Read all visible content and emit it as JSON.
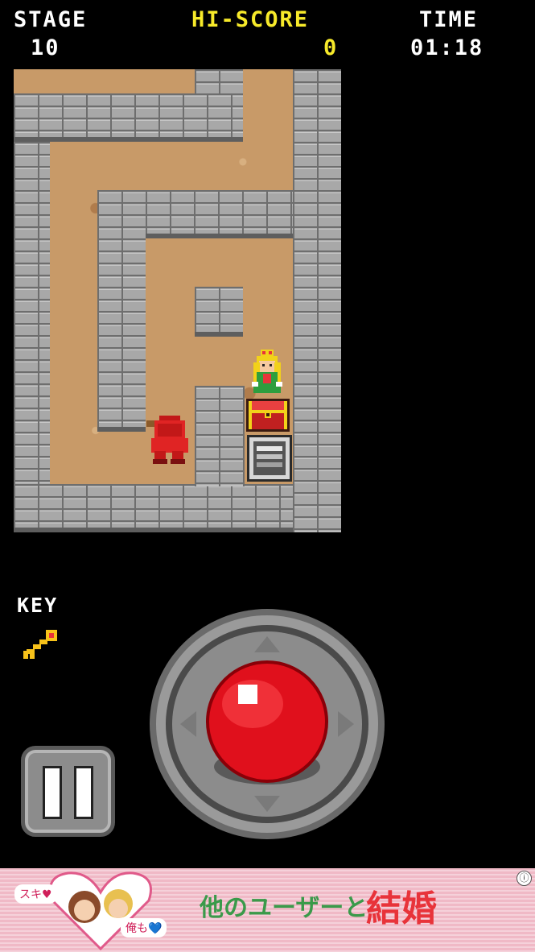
{
  "hud": {
    "stage_label": "STAGE",
    "stage_value": "10",
    "hiscore_label": "HI-SCORE",
    "hiscore_value": "0",
    "time_label": "TIME",
    "time_value": "01:18"
  },
  "inventory": {
    "key_label": "KEY",
    "key_icon": "key-icon"
  },
  "controls": {
    "pause_icon": "pause-icon",
    "joystick_icon": "joystick-icon"
  },
  "ad": {
    "bubble_left": "スキ♥",
    "bubble_right": "俺も💙",
    "headline": "他のユーザーと",
    "emphasis": "結婚",
    "info_icon": "ⓘ"
  },
  "colors": {
    "hud_white": "#ffffff",
    "hud_yellow": "#f7ea2a",
    "floor": "#c89a68",
    "wall": "#a8a8a8",
    "joystick_ball": "#e0101c"
  }
}
